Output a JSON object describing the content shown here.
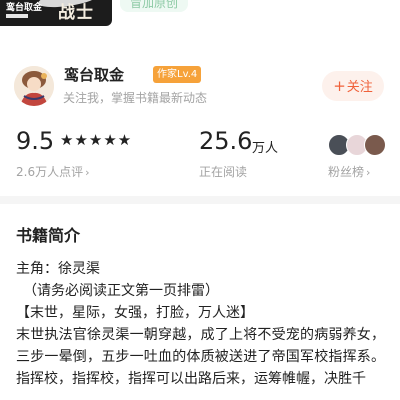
{
  "cover": {
    "brand": "鸾台取金",
    "title": "战士"
  },
  "tag": "冒加原创",
  "author": {
    "name": "鸾台取金",
    "level": "作家Lv.4",
    "tip": "关注我，掌握书籍最新动态",
    "follow_label": "关注",
    "follow_icon": "+"
  },
  "stats": {
    "rating": "9.5",
    "stars": "★★★★★",
    "rating_count": "2.6万人点评",
    "reading_value": "25.6",
    "reading_unit": "万人",
    "reading_label": "正在阅读",
    "fans_label": "粉丝榜",
    "chevron": "›"
  },
  "intro": {
    "title": "书籍简介",
    "lines": [
      "主角：徐灵渠",
      "（请务必阅读正文第一页排雷）",
      "【末世，星际，女强，打脸，万人迷】",
      "末世执法官徐灵渠一朝穿越，成了上将不受宠的病弱养女，三步一晕倒，五步一吐血的体质被送进了帝国军校指挥系。",
      "指挥校，指挥校，指挥可以出路后来，运筹帷幄，决胜千"
    ]
  },
  "colors": {
    "accent": "#f0613a",
    "badge": "#f6a23a",
    "muted": "#a3a3a3"
  }
}
